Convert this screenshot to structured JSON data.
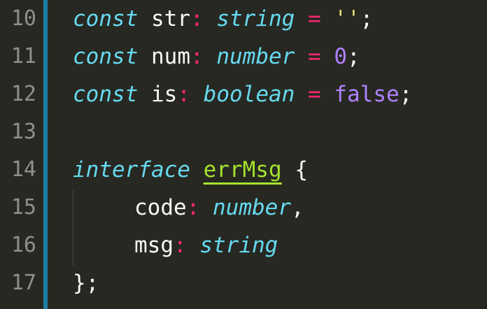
{
  "editor": {
    "line_numbers": [
      "10",
      "11",
      "12",
      "13",
      "14",
      "15",
      "16",
      "17"
    ],
    "lines": {
      "l10": {
        "keyword": "const",
        "name": "str",
        "colon": ":",
        "type": "string",
        "eq": "=",
        "value": "''",
        "semi": ";"
      },
      "l11": {
        "keyword": "const",
        "name": "num",
        "colon": ":",
        "type": "number",
        "eq": "=",
        "value": "0",
        "semi": ";"
      },
      "l12": {
        "keyword": "const",
        "name": "is",
        "colon": ":",
        "type": "boolean",
        "eq": "=",
        "value": "false",
        "semi": ";"
      },
      "l14": {
        "keyword": "interface",
        "name": "errMsg",
        "brace": "{"
      },
      "l15": {
        "name": "code",
        "colon": ":",
        "type": "number",
        "comma": ","
      },
      "l16": {
        "name": "msg",
        "colon": ":",
        "type": "string"
      },
      "l17": {
        "text": "};"
      }
    },
    "colors": {
      "background": "#272822",
      "gutter_accent": "#1e7fa6",
      "line_number": "#8f908a",
      "keyword": "#66d9ef",
      "operator": "#f92672",
      "string": "#e6db74",
      "constant": "#ae81ff",
      "identifier": "#f8f8f2",
      "interface_name": "#a6e22e"
    }
  }
}
